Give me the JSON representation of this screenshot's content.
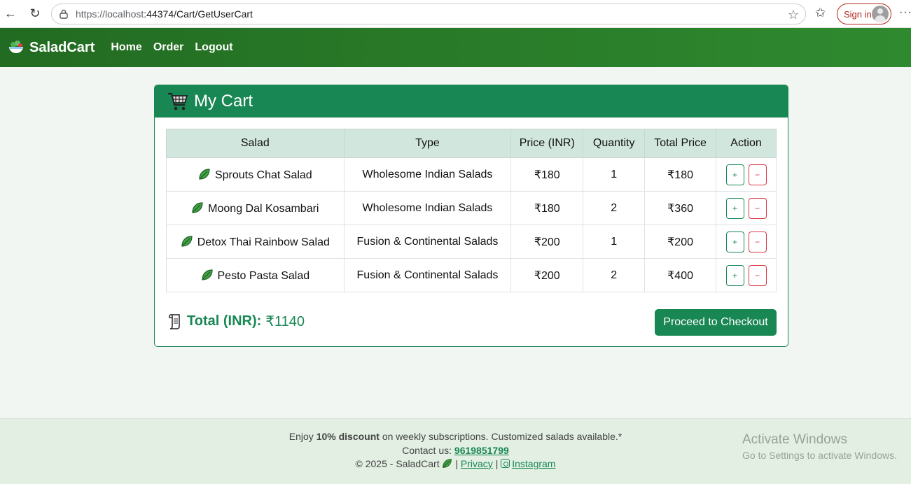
{
  "browser": {
    "url_host": "https://localhost",
    "url_rest": ":44374/Cart/GetUserCart",
    "signin_label": "Sign in"
  },
  "navbar": {
    "brand": "SaladCart",
    "links": [
      "Home",
      "Order",
      "Logout"
    ]
  },
  "cart": {
    "title": "My Cart",
    "columns": [
      "Salad",
      "Type",
      "Price (INR)",
      "Quantity",
      "Total Price",
      "Action"
    ],
    "items": [
      {
        "salad": "Sprouts Chat Salad",
        "type": "Wholesome Indian Salads",
        "price": "₹180",
        "quantity": "1",
        "total": "₹180"
      },
      {
        "salad": "Moong Dal Kosambari",
        "type": "Wholesome Indian Salads",
        "price": "₹180",
        "quantity": "2",
        "total": "₹360"
      },
      {
        "salad": "Detox Thai Rainbow Salad",
        "type": "Fusion & Continental Salads",
        "price": "₹200",
        "quantity": "1",
        "total": "₹200"
      },
      {
        "salad": "Pesto Pasta Salad",
        "type": "Fusion & Continental Salads",
        "price": "₹200",
        "quantity": "2",
        "total": "₹400"
      }
    ],
    "plus_label": "+",
    "minus_label": "−",
    "total_label": "Total (INR):",
    "total_value": "₹1140",
    "checkout_label": "Proceed to Checkout"
  },
  "footer": {
    "line1_pre": "Enjoy ",
    "line1_bold": "10% discount",
    "line1_post": " on weekly subscriptions. Customized salads available.*",
    "contact_pre": "Contact us: ",
    "phone": "9619851799",
    "copyright": "© 2025 - SaladCart",
    "sep": "|",
    "privacy": "Privacy",
    "instagram": "Instagram"
  },
  "watermark": {
    "title": "Activate Windows",
    "subtitle": "Go to Settings to activate Windows."
  },
  "colors": {
    "primary": "#198754",
    "navbar": "#2a7d2a",
    "danger": "#dc3545",
    "table_head": "#d1e7dd"
  }
}
